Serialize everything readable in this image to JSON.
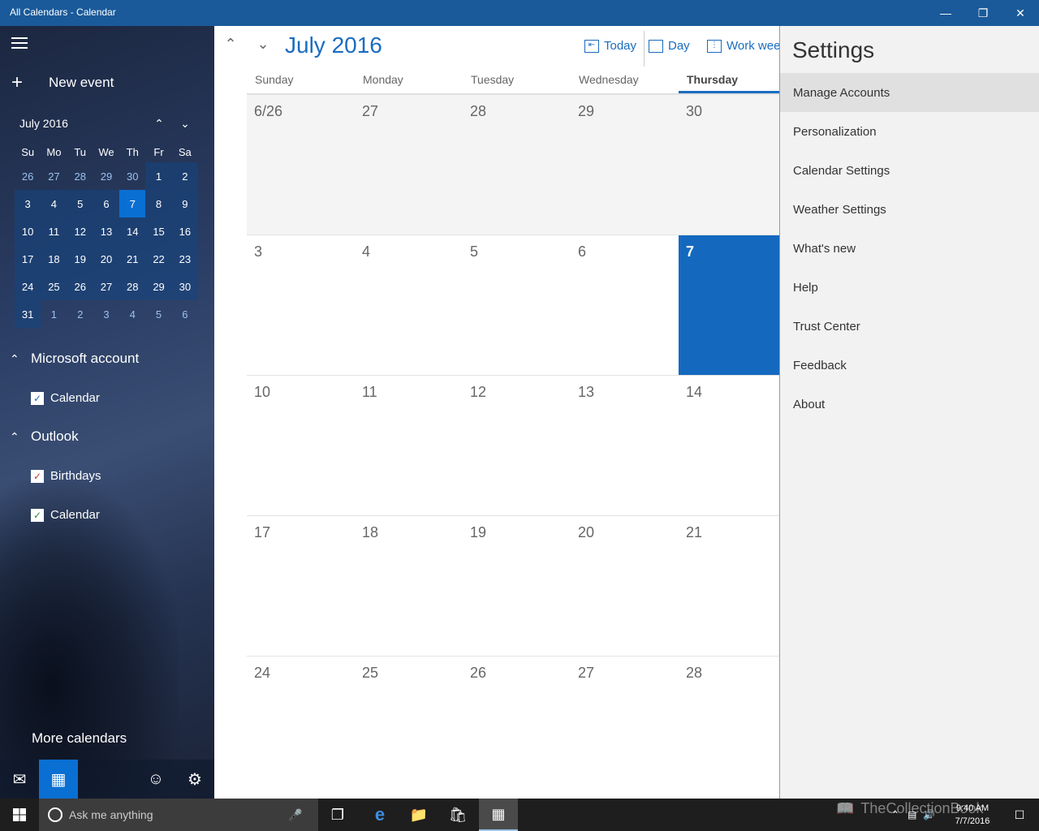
{
  "window": {
    "title": "All Calendars - Calendar",
    "minimize": "—",
    "restore": "❐",
    "close": "✕"
  },
  "sidebar": {
    "new_event": "New event",
    "mini_calendar": {
      "month_label": "July 2016",
      "weekdays": [
        "Su",
        "Mo",
        "Tu",
        "We",
        "Th",
        "Fr",
        "Sa"
      ],
      "weeks": [
        [
          "26",
          "27",
          "28",
          "29",
          "30",
          "1",
          "2"
        ],
        [
          "3",
          "4",
          "5",
          "6",
          "7",
          "8",
          "9"
        ],
        [
          "10",
          "11",
          "12",
          "13",
          "14",
          "15",
          "16"
        ],
        [
          "17",
          "18",
          "19",
          "20",
          "21",
          "22",
          "23"
        ],
        [
          "24",
          "25",
          "26",
          "27",
          "28",
          "29",
          "30"
        ],
        [
          "31",
          "1",
          "2",
          "3",
          "4",
          "5",
          "6"
        ]
      ],
      "today": "7"
    },
    "groups": [
      {
        "name": "Microsoft account",
        "calendars": [
          {
            "label": "Calendar",
            "checked": true,
            "color": "#1a6cc0"
          }
        ]
      },
      {
        "name": "Outlook",
        "calendars": [
          {
            "label": "Birthdays",
            "checked": true,
            "color": "#c1392b"
          },
          {
            "label": "Calendar",
            "checked": true,
            "color": "#2e8b3a"
          }
        ]
      }
    ],
    "more_calendars": "More calendars"
  },
  "toolbar": {
    "month_title": "July 2016",
    "today_label": "Today",
    "day_label": "Day",
    "work_week_label": "Work week"
  },
  "month_view": {
    "weekdays": [
      "Sunday",
      "Monday",
      "Tuesday",
      "Wednesday",
      "Thursday"
    ],
    "weeks": [
      [
        "6/26",
        "27",
        "28",
        "29",
        "30"
      ],
      [
        "3",
        "4",
        "5",
        "6",
        "7"
      ],
      [
        "10",
        "11",
        "12",
        "13",
        "14"
      ],
      [
        "17",
        "18",
        "19",
        "20",
        "21"
      ],
      [
        "24",
        "25",
        "26",
        "27",
        "28"
      ]
    ],
    "selected_weekday": "Thursday",
    "today": "7"
  },
  "settings": {
    "title": "Settings",
    "items": [
      "Manage Accounts",
      "Personalization",
      "Calendar Settings",
      "Weather Settings",
      "What's new",
      "Help",
      "Trust Center",
      "Feedback",
      "About"
    ],
    "selected": "Manage Accounts"
  },
  "taskbar": {
    "search_placeholder": "Ask me anything",
    "time": "9:40 AM",
    "date": "7/7/2016",
    "watermark": "TheCollectionBook"
  },
  "colors": {
    "accent": "#1a6cc0",
    "titlebar": "#1a5a9a",
    "today_cell": "#1469bf"
  }
}
